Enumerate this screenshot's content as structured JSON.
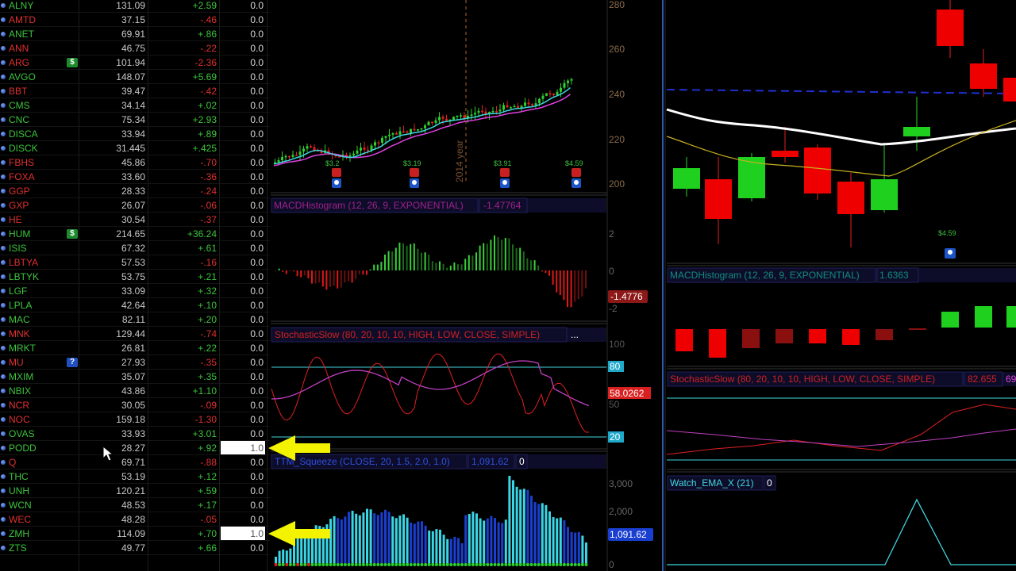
{
  "watchlist": {
    "rows": [
      {
        "symbol": "ALNY",
        "last": "131.09",
        "change": "+2.59",
        "value": "0.0",
        "dir": "up"
      },
      {
        "symbol": "AMTD",
        "last": "37.15",
        "change": "-.46",
        "value": "0.0",
        "dir": "dn"
      },
      {
        "symbol": "ANET",
        "last": "69.91",
        "change": "+.86",
        "value": "0.0",
        "dir": "up"
      },
      {
        "symbol": "ANN",
        "last": "46.75",
        "change": "-.22",
        "value": "0.0",
        "dir": "dn"
      },
      {
        "symbol": "ARG",
        "last": "101.94",
        "change": "-2.36",
        "value": "0.0",
        "dir": "dn",
        "badge": "$"
      },
      {
        "symbol": "AVGO",
        "last": "148.07",
        "change": "+5.69",
        "value": "0.0",
        "dir": "up"
      },
      {
        "symbol": "BBT",
        "last": "39.47",
        "change": "-.42",
        "value": "0.0",
        "dir": "dn"
      },
      {
        "symbol": "CMS",
        "last": "34.14",
        "change": "+.02",
        "value": "0.0",
        "dir": "up"
      },
      {
        "symbol": "CNC",
        "last": "75.34",
        "change": "+2.93",
        "value": "0.0",
        "dir": "up"
      },
      {
        "symbol": "DISCA",
        "last": "33.94",
        "change": "+.89",
        "value": "0.0",
        "dir": "up"
      },
      {
        "symbol": "DISCK",
        "last": "31.445",
        "change": "+.425",
        "value": "0.0",
        "dir": "up"
      },
      {
        "symbol": "FBHS",
        "last": "45.86",
        "change": "-.70",
        "value": "0.0",
        "dir": "dn"
      },
      {
        "symbol": "FOXA",
        "last": "33.60",
        "change": "-.36",
        "value": "0.0",
        "dir": "dn"
      },
      {
        "symbol": "GGP",
        "last": "28.33",
        "change": "-.24",
        "value": "0.0",
        "dir": "dn"
      },
      {
        "symbol": "GXP",
        "last": "26.07",
        "change": "-.06",
        "value": "0.0",
        "dir": "dn"
      },
      {
        "symbol": "HE",
        "last": "30.54",
        "change": "-.37",
        "value": "0.0",
        "dir": "dn"
      },
      {
        "symbol": "HUM",
        "last": "214.65",
        "change": "+36.24",
        "value": "0.0",
        "dir": "up",
        "badge": "$"
      },
      {
        "symbol": "ISIS",
        "last": "67.32",
        "change": "+.61",
        "value": "0.0",
        "dir": "up"
      },
      {
        "symbol": "LBTYA",
        "last": "57.53",
        "change": "-.16",
        "value": "0.0",
        "dir": "dn"
      },
      {
        "symbol": "LBTYK",
        "last": "53.75",
        "change": "+.21",
        "value": "0.0",
        "dir": "up"
      },
      {
        "symbol": "LGF",
        "last": "33.09",
        "change": "+.32",
        "value": "0.0",
        "dir": "up"
      },
      {
        "symbol": "LPLA",
        "last": "42.64",
        "change": "+.10",
        "value": "0.0",
        "dir": "up"
      },
      {
        "symbol": "MAC",
        "last": "82.11",
        "change": "+.20",
        "value": "0.0",
        "dir": "up"
      },
      {
        "symbol": "MNK",
        "last": "129.44",
        "change": "-.74",
        "value": "0.0",
        "dir": "dn"
      },
      {
        "symbol": "MRKT",
        "last": "26.81",
        "change": "+.22",
        "value": "0.0",
        "dir": "up"
      },
      {
        "symbol": "MU",
        "last": "27.93",
        "change": "-.35",
        "value": "0.0",
        "dir": "dn",
        "badge": "?"
      },
      {
        "symbol": "MXIM",
        "last": "35.07",
        "change": "+.35",
        "value": "0.0",
        "dir": "up"
      },
      {
        "symbol": "NBIX",
        "last": "43.86",
        "change": "+1.10",
        "value": "0.0",
        "dir": "up"
      },
      {
        "symbol": "NCR",
        "last": "30.05",
        "change": "-.09",
        "value": "0.0",
        "dir": "dn"
      },
      {
        "symbol": "NOC",
        "last": "159.18",
        "change": "-1.30",
        "value": "0.0",
        "dir": "dn"
      },
      {
        "symbol": "OVAS",
        "last": "33.93",
        "change": "+3.01",
        "value": "0.0",
        "dir": "up"
      },
      {
        "symbol": "PODD",
        "last": "28.27",
        "change": "+.92",
        "value": "1.0",
        "dir": "up",
        "highlight": true
      },
      {
        "symbol": "Q",
        "last": "69.71",
        "change": "-.88",
        "value": "0.0",
        "dir": "dn"
      },
      {
        "symbol": "THC",
        "last": "53.19",
        "change": "+.12",
        "value": "0.0",
        "dir": "up"
      },
      {
        "symbol": "UNH",
        "last": "120.21",
        "change": "+.59",
        "value": "0.0",
        "dir": "up"
      },
      {
        "symbol": "WCN",
        "last": "48.53",
        "change": "+.17",
        "value": "0.0",
        "dir": "up"
      },
      {
        "symbol": "WEC",
        "last": "48.28",
        "change": "-.05",
        "value": "0.0",
        "dir": "dn"
      },
      {
        "symbol": "ZMH",
        "last": "114.09",
        "change": "+.70",
        "value": "1.0",
        "dir": "up",
        "highlight": true
      },
      {
        "symbol": "ZTS",
        "last": "49.77",
        "change": "+.66",
        "value": "0.0",
        "dir": "up"
      }
    ]
  },
  "chart1": {
    "price_axis": [
      "280",
      "260",
      "240",
      "220",
      "200"
    ],
    "year_label": "2014 year",
    "dividends": [
      "$3.2",
      "$3.19",
      "$3.91",
      "$4.59"
    ],
    "macd": {
      "title": "MACDHistogram (12, 26, 9, EXPONENTIAL)",
      "value": "-1.47764",
      "axis": [
        "2",
        "0"
      ],
      "badge": "-1.4776",
      "axis_low": "-2"
    },
    "stoch": {
      "title": "StochasticSlow (80, 20, 10, 10, HIGH, LOW, CLOSE, SIMPLE)",
      "more": "...",
      "axis_top": "100",
      "axis_mid": "50",
      "level_high": "80",
      "level_low": "20",
      "badge": "58.0262"
    },
    "squeeze": {
      "title": "TTM_Squeeze (CLOSE, 20, 1.5, 2.0, 1.0)",
      "value": "1,091.62",
      "extra": "0",
      "axis": [
        "3,000",
        "2,000",
        "0"
      ],
      "badge": "1,091.62"
    }
  },
  "chart2": {
    "dividend": "$4.59",
    "macd": {
      "title": "MACDHistogram (12, 26, 9, EXPONENTIAL)",
      "value": "1.6363"
    },
    "stoch": {
      "title": "StochasticSlow (80, 20, 10, 10, HIGH, LOW, CLOSE, SIMPLE)",
      "value": "82.655",
      "extra": "69"
    },
    "ema": {
      "title": "Watch_EMA_X (21)",
      "value": "0"
    }
  },
  "colors": {
    "up": "#3cc43c",
    "down": "#e03030",
    "cyan": "#3fd6e0",
    "magenta": "#e040e0",
    "panel_title_bg": "#0d0d2a"
  }
}
